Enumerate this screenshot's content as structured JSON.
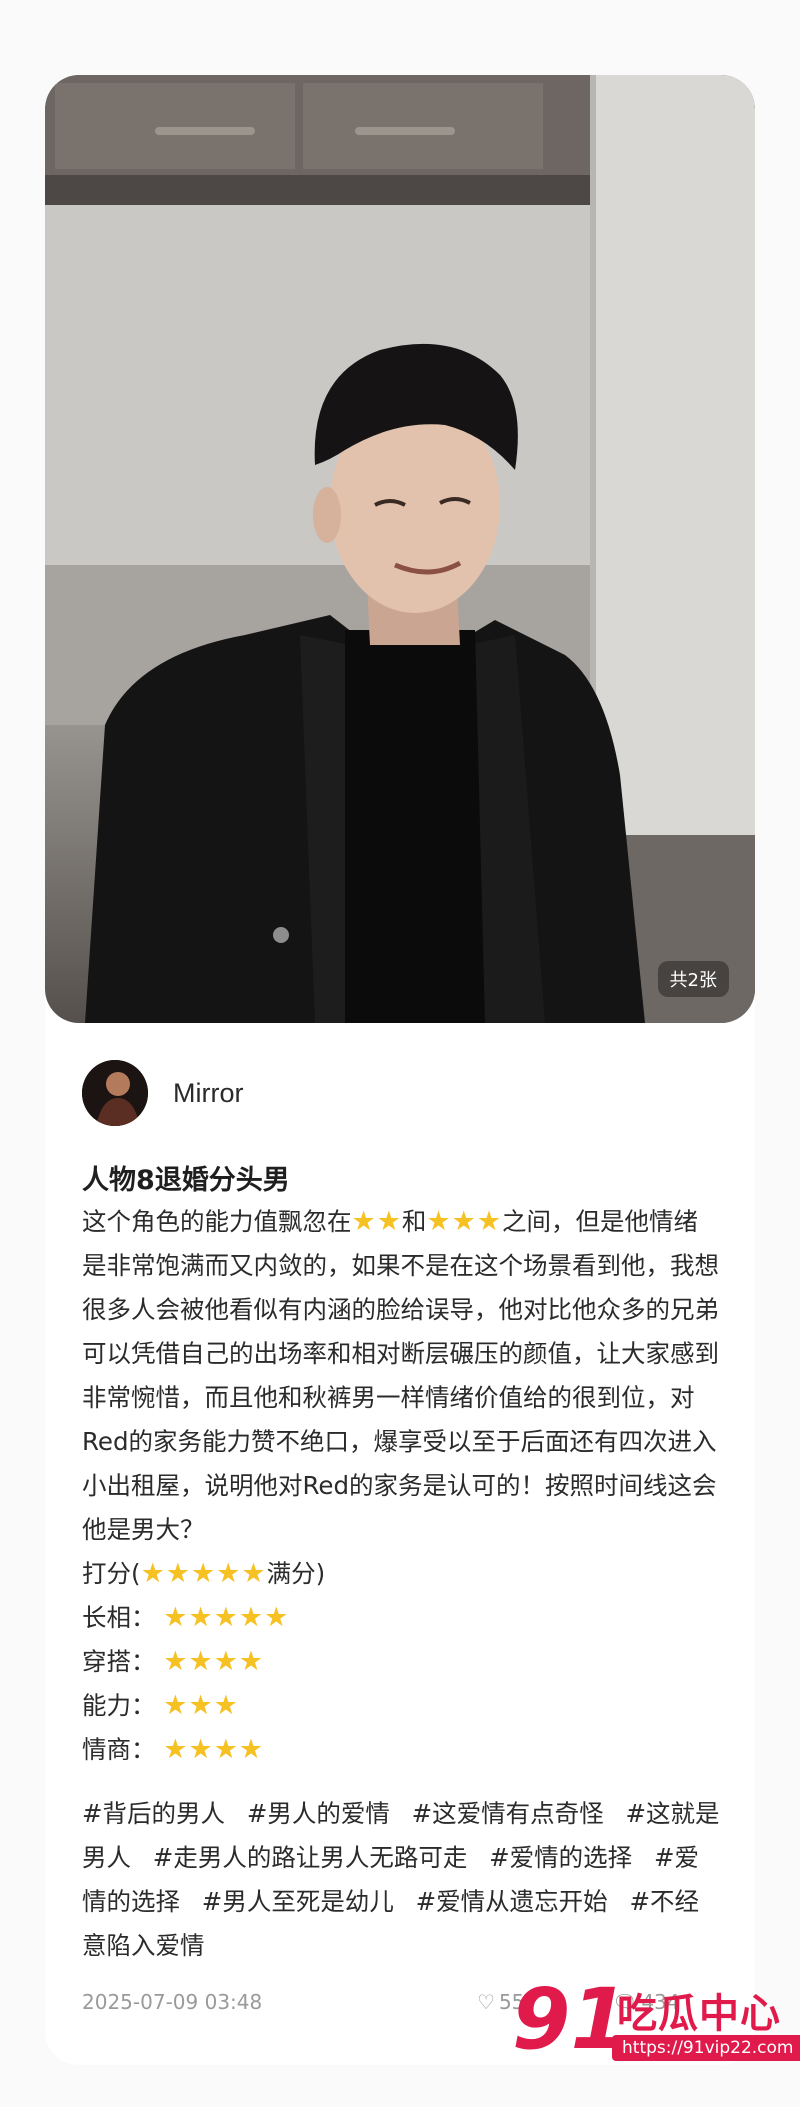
{
  "post": {
    "photo_count": "共2张",
    "author_name": "Mirror",
    "title": "人物8退婚分头男",
    "body": {
      "p1_a": "这个角色的能力值飘忽在",
      "p1_b": "和",
      "p1_c": "之间，但是他情绪是非常饱满而又内敛的，如果不是在这个场景看到他，我想很多人会被他看似有内涵的脸给误导，他对比他众多的兄弟可以凭借自己的出场率和相对断层碾压的颜值，让大家感到非常惋惜，而且他和秋裤男一样情绪价值给的很到位，对Red的家务能力赞不绝口，爆享受以至于后面还有四次进入小出租屋，说明他对Red的家务是认可的！按照时间线这会他是男大？",
      "score_prefix": "打分(",
      "score_suffix": "满分)"
    },
    "ratings": [
      {
        "label": "长相：",
        "stars": 5
      },
      {
        "label": "穿搭：",
        "stars": 4
      },
      {
        "label": "能力：",
        "stars": 3
      },
      {
        "label": "情商：",
        "stars": 4
      }
    ],
    "star_glyphs": {
      "two": "★★",
      "three": "★★★",
      "four": "★★★★",
      "five": "★★★★★"
    },
    "tags": [
      "#背后的男人",
      "#男人的爱情",
      "#这爱情有点奇怪",
      "#这就是男人",
      "#走男人的路让男人无路可走",
      "#爱情的选择",
      "#爱情的选择",
      "#男人至死是幼儿",
      "#爱情从遗忘开始",
      "#不经意陷入爱情"
    ],
    "date": "2025-07-09 03:48",
    "likes": "55",
    "comments": "434"
  },
  "icons": {
    "like": "heart-icon",
    "comment": "comment-bubble-icon"
  },
  "watermark": {
    "number": "91",
    "name": "吃瓜中心",
    "url": "https://91vip22.com"
  },
  "colors": {
    "star": "#f6c122",
    "watermark": "#e01b4c"
  }
}
